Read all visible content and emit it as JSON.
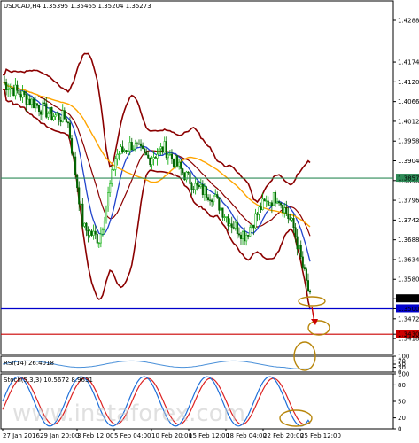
{
  "header": {
    "title": "USDCAD,H4  1.35395 1.35465 1.35204 1.35273"
  },
  "price_axis": {
    "ticks": [
      "1.42885",
      "1.41745",
      "1.41205",
      "1.40665",
      "1.40125",
      "1.39585",
      "1.39045",
      "1.38505",
      "1.37965",
      "1.37425",
      "1.36885",
      "1.36345",
      "1.35805",
      "1.35273",
      "1.35000",
      "1.34725",
      "1.34304",
      "1.34185"
    ],
    "highlight": {
      "current": "1.35273",
      "blue_level": "1.35000",
      "red_level": "1.34304",
      "green_level": "1.38571"
    }
  },
  "rsi": {
    "title": "RSI(14) 26.4018",
    "ticks": [
      "100",
      "70",
      "50",
      "30",
      "0"
    ]
  },
  "stoch": {
    "title": "Stoch(5,3,3) 10.5672 8.9631",
    "ticks": [
      "100",
      "80",
      "50",
      "20",
      "0"
    ]
  },
  "time_axis": {
    "ticks": [
      "27 Jan 2016",
      "29 Jan 20:00",
      "3 Feb 12:00",
      "5 Feb 04:00",
      "10 Feb 20:00",
      "15 Feb 12:00",
      "18 Feb 04:00",
      "22 Feb 20:00",
      "25 Feb 12:00"
    ]
  },
  "watermark": "www.instaforex.com",
  "colors": {
    "up": "#00aa00",
    "down": "#006400",
    "bb": "#8b0000",
    "ma_fast": "#2244cc",
    "ma_slow": "#ffa500",
    "rsi_line": "#4a90d9",
    "stoch_main": "#1e6fd9",
    "stoch_signal": "#dd2222",
    "blue_line": "#0000cc",
    "red_line": "#cc0000",
    "green_line": "#2e8b57",
    "circle": "#b8860b"
  },
  "chart_data": {
    "type": "line",
    "symbol": "USDCAD",
    "timeframe": "H4",
    "x": [
      "27 Jan 2016",
      "29 Jan 20:00",
      "3 Feb 12:00",
      "5 Feb 04:00",
      "10 Feb 20:00",
      "15 Feb 12:00",
      "18 Feb 04:00",
      "22 Feb 20:00",
      "25 Feb 12:00"
    ],
    "series": [
      {
        "name": "",
        "values": [
          1.412,
          1.403,
          1.372,
          1.392,
          1.391,
          1.383,
          1.374,
          1.378,
          1.3527
        ]
      }
    ],
    "levels": [
      1.38571,
      1.35,
      1.34304
    ],
    "ylim": [
      1.338,
      1.432
    ],
    "rsi_last": 26.4018,
    "stoch_last": [
      10.5672,
      8.9631
    ]
  }
}
